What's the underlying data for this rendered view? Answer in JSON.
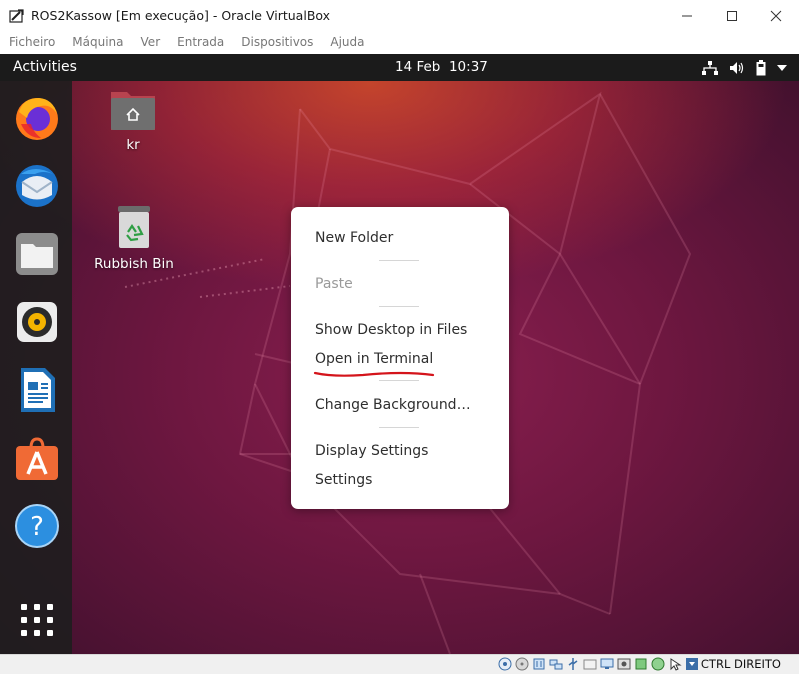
{
  "window": {
    "title": "ROS2Kassow [Em execução] - Oracle VirtualBox",
    "menu": [
      "Ficheiro",
      "Máquina",
      "Ver",
      "Entrada",
      "Dispositivos",
      "Ajuda"
    ]
  },
  "topbar": {
    "activities": "Activities",
    "date": "14 Feb",
    "time": "10:37"
  },
  "dock": [
    {
      "name": "firefox"
    },
    {
      "name": "thunderbird"
    },
    {
      "name": "files"
    },
    {
      "name": "rhythmbox"
    },
    {
      "name": "libreoffice-writer"
    },
    {
      "name": "ubuntu-software"
    },
    {
      "name": "help"
    },
    {
      "name": "show-applications"
    }
  ],
  "desktop": {
    "home_label": "kr",
    "trash_label": "Rubbish Bin"
  },
  "context_menu": {
    "new_folder": "New Folder",
    "paste": "Paste",
    "show_desktop_in_files": "Show Desktop in Files",
    "open_in_terminal": "Open in Terminal",
    "change_background": "Change Background…",
    "display_settings": "Display Settings",
    "settings": "Settings"
  },
  "annotation": {
    "color": "#d4141b"
  },
  "statusbar": {
    "host_key": "CTRL DIREITO"
  }
}
